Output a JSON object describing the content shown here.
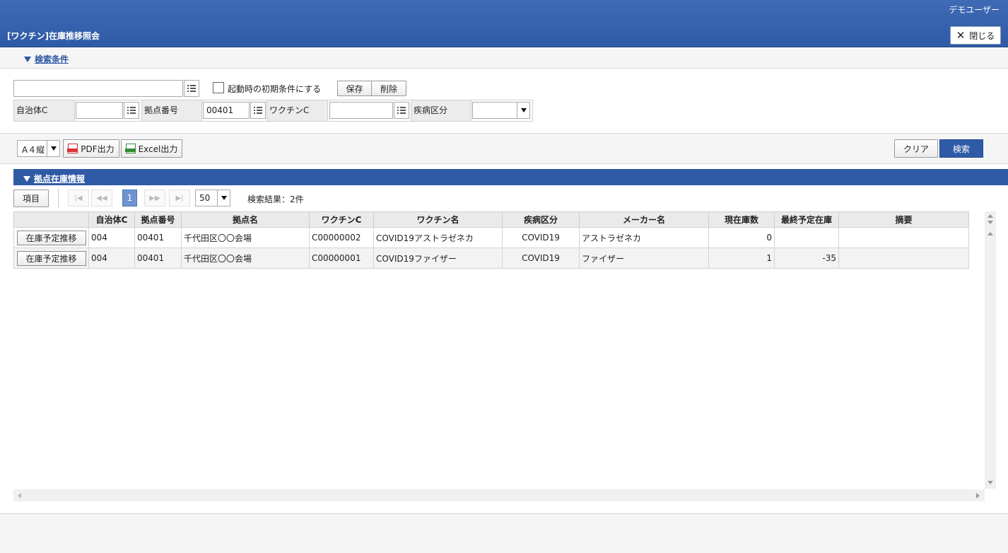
{
  "header": {
    "user": "デモユーザー",
    "title": "[ワクチン]在庫推移照会",
    "close_label": "閉じる"
  },
  "search_conditions": {
    "section_title": "検索条件",
    "preset_value": "",
    "initial_checkbox_label": "起動時の初期条件にする",
    "initial_checked": false,
    "save_label": "保存",
    "delete_label": "削除",
    "fields": {
      "municipality_label": "自治体C",
      "municipality_value": "",
      "site_no_label": "拠点番号",
      "site_no_value": "00401",
      "vaccine_label": "ワクチンC",
      "vaccine_value": "",
      "disease_label": "疾病区分",
      "disease_value": ""
    }
  },
  "toolbar": {
    "paper_size": "A４縦",
    "pdf_label": "PDF出力",
    "excel_label": "Excel出力",
    "clear_label": "クリア",
    "search_label": "検索"
  },
  "grid": {
    "section_title": "拠点在庫情報",
    "columns_button": "項目",
    "pager": {
      "first": "|◀",
      "prev": "◀◀",
      "current_page": "1",
      "next": "▶▶",
      "last": "▶|"
    },
    "page_size": "50",
    "result_text": "検索結果：2件",
    "headers": [
      "",
      "自治体C",
      "拠点番号",
      "拠点名",
      "ワクチンC",
      "ワクチン名",
      "疾病区分",
      "メーカー名",
      "現在庫数",
      "最終予定在庫",
      "摘要"
    ],
    "rows": [
      {
        "action": "在庫予定推移",
        "municipality": "004",
        "site_no": "00401",
        "site_name": "千代田区〇〇会場",
        "vaccine_code": "C00000002",
        "vaccine_name": "COVID19アストラゼネカ",
        "disease": "COVID19",
        "maker": "アストラゼネカ",
        "stock": "0",
        "final_stock": "",
        "note": ""
      },
      {
        "action": "在庫予定推移",
        "municipality": "004",
        "site_no": "00401",
        "site_name": "千代田区〇〇会場",
        "vaccine_code": "C00000001",
        "vaccine_name": "COVID19ファイザー",
        "disease": "COVID19",
        "maker": "ファイザー",
        "stock": "1",
        "final_stock": "-35",
        "note": ""
      }
    ]
  },
  "colors": {
    "header_blue": "#2f5aa6",
    "page_current": "#6f93cf"
  }
}
